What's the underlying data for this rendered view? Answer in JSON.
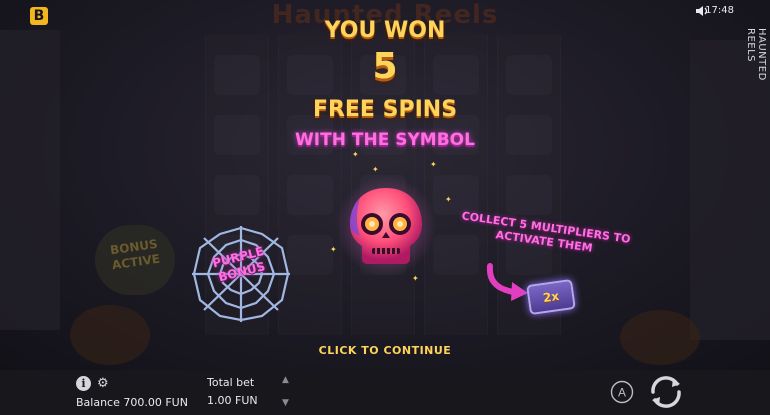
{
  "game": {
    "title": "HAUNTED REELS",
    "brand_logo": "B",
    "background_title": "Haunted Reels"
  },
  "status": {
    "time": "17:48",
    "sound_icon": "speaker-icon"
  },
  "popup": {
    "line1": "YOU WON",
    "count": "5",
    "line2": "FREE SPINS",
    "line3": "WITH THE SYMBOL",
    "symbol_icon": "pink-skull-icon",
    "web_label": "PURPLE BONUS",
    "collect_text": "COLLECT 5 MULTIPLIERS TO ACTIVATE THEM",
    "multiplier_label": "2x",
    "continue_text": "CLICK TO CONTINUE"
  },
  "background": {
    "bonus_active": "BONUS ACTIVE"
  },
  "footer": {
    "balance": "Balance 700.00 FUN",
    "total_bet_label": "Total bet",
    "total_bet_value": "1.00 FUN",
    "autoplay_label": "A"
  },
  "colors": {
    "gold": "#ffd45a",
    "pink": "#ff6fe0",
    "brand": "#f2b71e",
    "background": "#1c1a24"
  }
}
